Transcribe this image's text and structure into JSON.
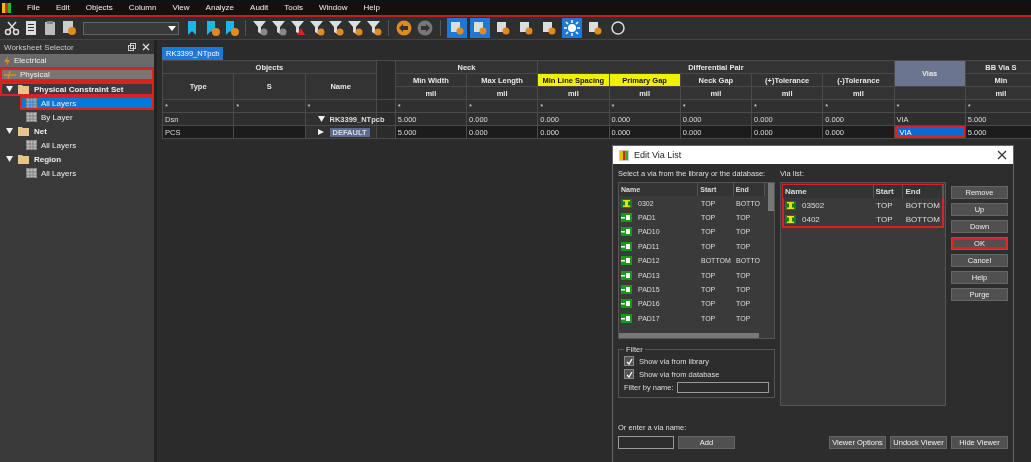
{
  "menu": [
    "File",
    "Edit",
    "Objects",
    "Column",
    "View",
    "Analyze",
    "Audit",
    "Tools",
    "Window",
    "Help"
  ],
  "toolbar": {
    "toggles": [
      {
        "selected": true
      },
      {
        "selected": true
      },
      {
        "selected": false
      },
      {
        "selected": false
      },
      {
        "selected": false
      },
      {
        "selected": true
      },
      {
        "selected": false
      },
      {
        "selected": false
      }
    ]
  },
  "worksheet_selector": {
    "title": "Worksheet Selector",
    "sections": [
      {
        "kind": "electrical",
        "label": "Electrical",
        "expanded": false,
        "marked": false
      },
      {
        "kind": "physical",
        "label": "Physical",
        "expanded": true,
        "marked": true,
        "children": [
          {
            "label": "Physical Constraint Set",
            "expanded": true,
            "marked": true,
            "children": [
              {
                "label": "All Layers",
                "selected": true,
                "marked": true
              },
              {
                "label": "By Layer",
                "selected": false,
                "marked": false
              }
            ]
          },
          {
            "label": "Net",
            "expanded": true,
            "marked": false,
            "children": [
              {
                "label": "All Layers",
                "selected": false,
                "marked": false
              }
            ]
          },
          {
            "label": "Region",
            "expanded": true,
            "marked": false,
            "children": [
              {
                "label": "All Layers",
                "selected": false,
                "marked": false
              }
            ]
          }
        ]
      }
    ]
  },
  "tab": {
    "label": "RK3399_NTpcb",
    "selected": true
  },
  "table": {
    "groups": [
      {
        "label": "Objects",
        "columns": [
          {
            "label": "Type",
            "filter": "*"
          },
          {
            "label": "S",
            "filter": "*"
          },
          {
            "label": "Name",
            "filter": "*"
          }
        ]
      },
      {
        "columns": [
          {
            "kind": "spacer"
          }
        ]
      },
      {
        "label": "Neck",
        "columns": [
          {
            "label": "Min Width",
            "unit": "mil",
            "filter": "*",
            "highlighted": false
          },
          {
            "label": "Max Length",
            "unit": "mil",
            "filter": "*",
            "highlighted": false
          }
        ]
      },
      {
        "label": "Differential Pair",
        "columns": [
          {
            "label": "Min Line Spacing",
            "unit": "mil",
            "filter": "*",
            "highlighted": true
          },
          {
            "label": "Primary Gap",
            "unit": "mil",
            "filter": "*",
            "highlighted": true
          },
          {
            "label": "Neck Gap",
            "unit": "mil",
            "filter": "*",
            "highlighted": false
          },
          {
            "label": "(+)Tolerance",
            "unit": "mil",
            "filter": "*",
            "highlighted": false
          },
          {
            "label": "(-)Tolerance",
            "unit": "mil",
            "filter": "*",
            "highlighted": false
          }
        ]
      },
      {
        "columns": [
          {
            "label": "Vias",
            "filter": "*",
            "selected": true
          }
        ]
      },
      {
        "label": "BB Via S",
        "columns": [
          {
            "label": "Min",
            "unit": "mil",
            "filter": "*",
            "highlighted": false
          }
        ]
      }
    ],
    "rows": [
      {
        "type": "Dsn",
        "name": "RK3399_NTpcb",
        "expanded": true,
        "selected": false,
        "cells": [
          {
            "text": "5.000",
            "selected": false,
            "marked": false
          },
          {
            "text": "0.000",
            "selected": false,
            "marked": false
          },
          {
            "text": "0.000",
            "selected": false,
            "marked": false
          },
          {
            "text": "0.000",
            "selected": false,
            "marked": false
          },
          {
            "text": "0.000",
            "selected": false,
            "marked": false
          },
          {
            "text": "0.000",
            "selected": false,
            "marked": false
          },
          {
            "text": "0.000",
            "selected": false,
            "marked": false
          },
          {
            "text": "VIA",
            "selected": false,
            "marked": false
          },
          {
            "text": "5.000",
            "selected": false,
            "marked": false
          }
        ]
      },
      {
        "type": "PCS",
        "name": "DEFAULT",
        "expanded": false,
        "selected": true,
        "cells": [
          {
            "text": "5.000",
            "selected": false,
            "marked": false
          },
          {
            "text": "0.000",
            "selected": false,
            "marked": false
          },
          {
            "text": "0.000",
            "selected": false,
            "marked": false
          },
          {
            "text": "0.000",
            "selected": false,
            "marked": false
          },
          {
            "text": "0.000",
            "selected": false,
            "marked": false
          },
          {
            "text": "0.000",
            "selected": false,
            "marked": false
          },
          {
            "text": "0.000",
            "selected": false,
            "marked": false
          },
          {
            "text": "VIA",
            "selected": true,
            "marked": true
          },
          {
            "text": "5.000",
            "selected": false,
            "marked": false
          }
        ]
      }
    ]
  },
  "dialog": {
    "title": "Edit Via List",
    "library_label": "Select a via from the library or the database:",
    "library_list": {
      "columns": [
        "Name",
        "Start",
        "End"
      ],
      "rows": [
        {
          "kind": "via",
          "name": "0302",
          "start": "TOP",
          "end": "BOTTO"
        },
        {
          "kind": "pad",
          "name": "PAD1",
          "start": "TOP",
          "end": "TOP"
        },
        {
          "kind": "pad",
          "name": "PAD10",
          "start": "TOP",
          "end": "TOP"
        },
        {
          "kind": "pad",
          "name": "PAD11",
          "start": "TOP",
          "end": "TOP"
        },
        {
          "kind": "pad",
          "name": "PAD12",
          "start": "BOTTOM",
          "end": "BOTTO"
        },
        {
          "kind": "pad",
          "name": "PAD13",
          "start": "TOP",
          "end": "TOP"
        },
        {
          "kind": "pad",
          "name": "PAD15",
          "start": "TOP",
          "end": "TOP"
        },
        {
          "kind": "pad",
          "name": "PAD16",
          "start": "TOP",
          "end": "TOP"
        },
        {
          "kind": "pad",
          "name": "PAD17",
          "start": "TOP",
          "end": "TOP"
        }
      ]
    },
    "via_list_label": "Via list:",
    "via_list": {
      "marked": true,
      "columns": [
        "Name",
        "Start",
        "End"
      ],
      "rows": [
        {
          "kind": "via",
          "name": "03502",
          "start": "TOP",
          "end": "BOTTOM"
        },
        {
          "kind": "via",
          "name": "0402",
          "start": "TOP",
          "end": "BOTTOM"
        }
      ]
    },
    "side_buttons": [
      {
        "label": "Remove",
        "marked": false
      },
      {
        "label": "Up",
        "marked": false
      },
      {
        "label": "Down",
        "marked": false
      },
      {
        "label": "OK",
        "marked": true
      },
      {
        "label": "Cancel",
        "marked": false
      },
      {
        "label": "Help",
        "marked": false
      },
      {
        "label": "Purge",
        "marked": false
      }
    ],
    "filter": {
      "title": "Filter",
      "options": [
        {
          "label": "Show via from library",
          "checked": true
        },
        {
          "label": "Show via from database",
          "checked": true
        }
      ],
      "name_label": "Filter by name:"
    },
    "enter_label": "Or enter a via name:",
    "add_button": "Add",
    "bottom_buttons": [
      "Viewer Options",
      "Undock Viewer",
      "Hide Viewer"
    ]
  }
}
